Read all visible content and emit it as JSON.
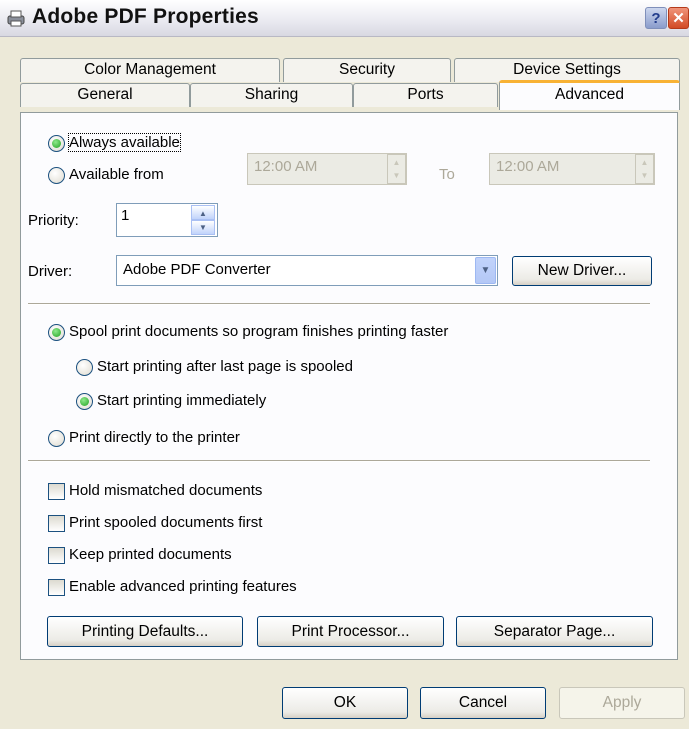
{
  "window": {
    "title": "Adobe PDF Properties",
    "help_label": "?",
    "close_label": "✕"
  },
  "tabs_back": [
    "Color Management",
    "Security",
    "Device Settings"
  ],
  "tabs_front": [
    "General",
    "Sharing",
    "Ports",
    "Advanced"
  ],
  "availability": {
    "always_label": "Always available",
    "from_label": "Available from",
    "from_time": "12:00 AM",
    "to_label": "To",
    "to_time": "12:00 AM"
  },
  "priority": {
    "label": "Priority:",
    "value": "1"
  },
  "driver": {
    "label": "Driver:",
    "value": "Adobe PDF Converter",
    "new_driver_label": "New Driver..."
  },
  "spooling": {
    "spool_label": "Spool print documents so program finishes printing faster",
    "after_last_label": "Start printing after last page is spooled",
    "immediately_label": "Start printing immediately",
    "direct_label": "Print directly to the printer"
  },
  "checkboxes": [
    "Hold mismatched documents",
    "Print spooled documents first",
    "Keep printed documents",
    "Enable advanced printing features"
  ],
  "panel_buttons": {
    "defaults": "Printing Defaults...",
    "processor": "Print Processor...",
    "separator": "Separator Page..."
  },
  "dialog_buttons": {
    "ok": "OK",
    "cancel": "Cancel",
    "apply": "Apply"
  }
}
